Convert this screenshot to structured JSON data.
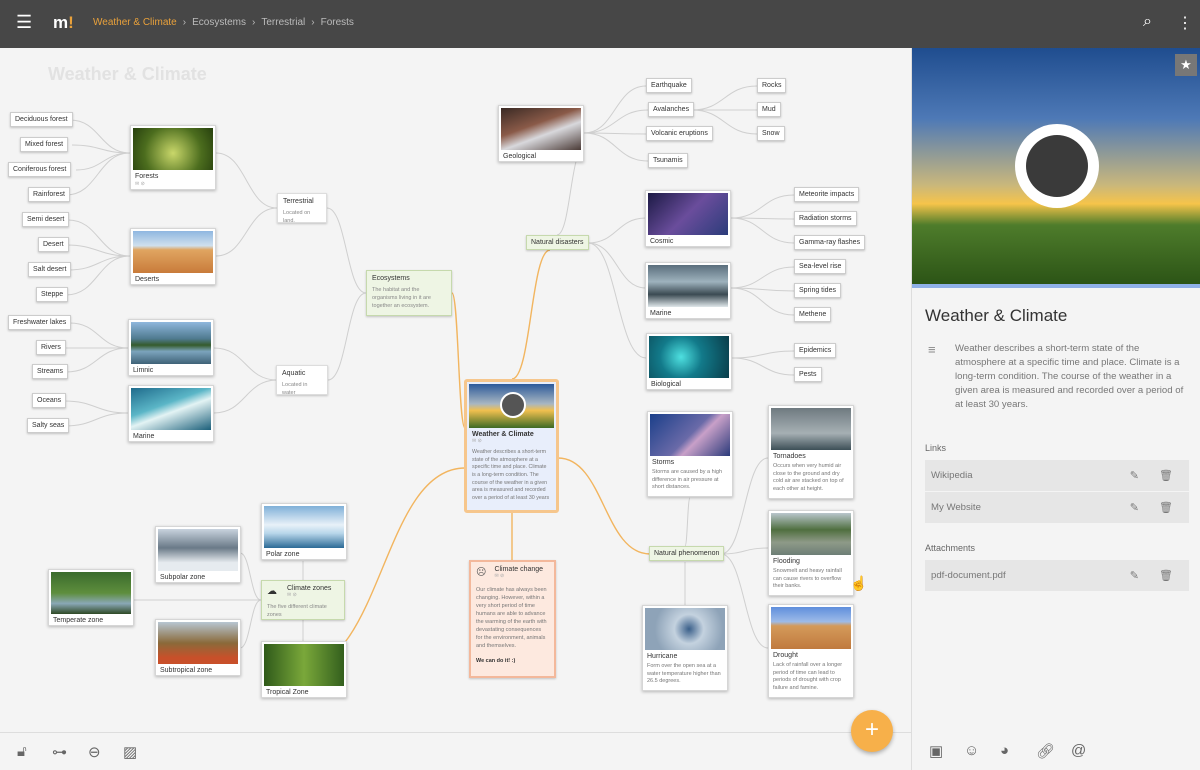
{
  "header": {
    "breadcrumb": [
      "Weather & Climate",
      "Ecosystems",
      "Terrestrial",
      "Forests"
    ],
    "logo": "m!",
    "icons": [
      "menu-icon",
      "search-icon",
      "more-vert-icon"
    ]
  },
  "canvas": {
    "title": "Weather & Climate"
  },
  "nodes": {
    "root": {
      "title": "Weather & Climate",
      "desc": "Weather describes a short-term state of the atmosphere at a specific time and place. Climate is a long-term condition. The course of the weather in a given area is measured and recorded over a period of at least 30 years"
    },
    "ecosystems": {
      "title": "Ecosystems",
      "desc": "The habitat and the organisms living in it are together an ecosystem."
    },
    "terrestrial": {
      "title": "Terrestrial",
      "desc": "Located on land."
    },
    "aquatic": {
      "title": "Aquatic",
      "desc": "Located in water"
    },
    "forests": "Forests",
    "deserts": "Deserts",
    "limnic": "Limnic",
    "marine_l": "Marine",
    "forest_tags": [
      "Deciduous forest",
      "Mixed forest",
      "Coniferous forest",
      "Rainforest"
    ],
    "desert_tags": [
      "Semi desert",
      "Desert",
      "Salt desert",
      "Steppe"
    ],
    "limnic_tags": [
      "Freshwater lakes",
      "Rivers",
      "Streams"
    ],
    "marine_tags": [
      "Oceans",
      "Salty seas"
    ],
    "natural_disasters": "Natural disasters",
    "geological": "Geological",
    "geo_tags": [
      "Earthquake",
      "Avalanches",
      "Volcanic eruptions",
      "Tsunamis"
    ],
    "aval_tags": [
      "Rocks",
      "Mud",
      "Snow"
    ],
    "cosmic": "Cosmic",
    "cosmic_tags": [
      "Meteorite impacts",
      "Radiation storms",
      "Gamma-ray flashes"
    ],
    "marine_r": "Marine",
    "marine_r_tags": [
      "Sea-level rise",
      "Spring tides",
      "Methene"
    ],
    "biological": "Biological",
    "bio_tags": [
      "Epidemics",
      "Pests"
    ],
    "natural_phenomenon": "Natural phenomenon",
    "storms": {
      "title": "Storms",
      "desc": "Storms are caused by a high difference in air pressure at short distances."
    },
    "tornadoes": {
      "title": "Tornadoes",
      "desc": "Occurs when very humid air close to the ground and dry cold air are stacked on top of each other at height."
    },
    "flooding": {
      "title": "Flooding",
      "desc": "Snowmelt and heavy rainfall can cause rivers to overflow their banks."
    },
    "hurricane": {
      "title": "Hurricane",
      "desc": "Form over the open sea at a water temperature higher than 26.5 degrees."
    },
    "drought": {
      "title": "Drought",
      "desc": "Lack of rainfall over a longer period of time can lead to periods of drought with crop failure and famine."
    },
    "climate_change": {
      "title": "Climate change",
      "desc": "Our climate has always been changing. However, within a very short period of time humans are able to advance the warming of the earth with devastating consequences for the environment, animals and themselves.",
      "footer": "We can do it! :)"
    },
    "climate_zones": {
      "title": "Climate zones",
      "desc": "The five different climate zones"
    },
    "polar": "Polar zone",
    "subpolar": "Subpolar zone",
    "temperate": "Temperate zone",
    "subtropical": "Subtropical zone",
    "tropical": "Tropical Zone"
  },
  "panel": {
    "title": "Weather & Climate",
    "desc": "Weather describes a short-term state of the atmosphere at a specific time and place. Climate is a long-term condition. The course of the weather in a given area is measured and recorded over a period of at least 30 years.",
    "links_label": "Links",
    "links": [
      "Wikipedia",
      "My Website"
    ],
    "attachments_label": "Attachments",
    "attachments": [
      "pdf-document.pdf"
    ]
  },
  "colors": {
    "header": "#474747",
    "accent": "#e9a13b",
    "fab": "#f7b04a",
    "green_node": "#eef5e4",
    "change_node": "#fde9df"
  }
}
